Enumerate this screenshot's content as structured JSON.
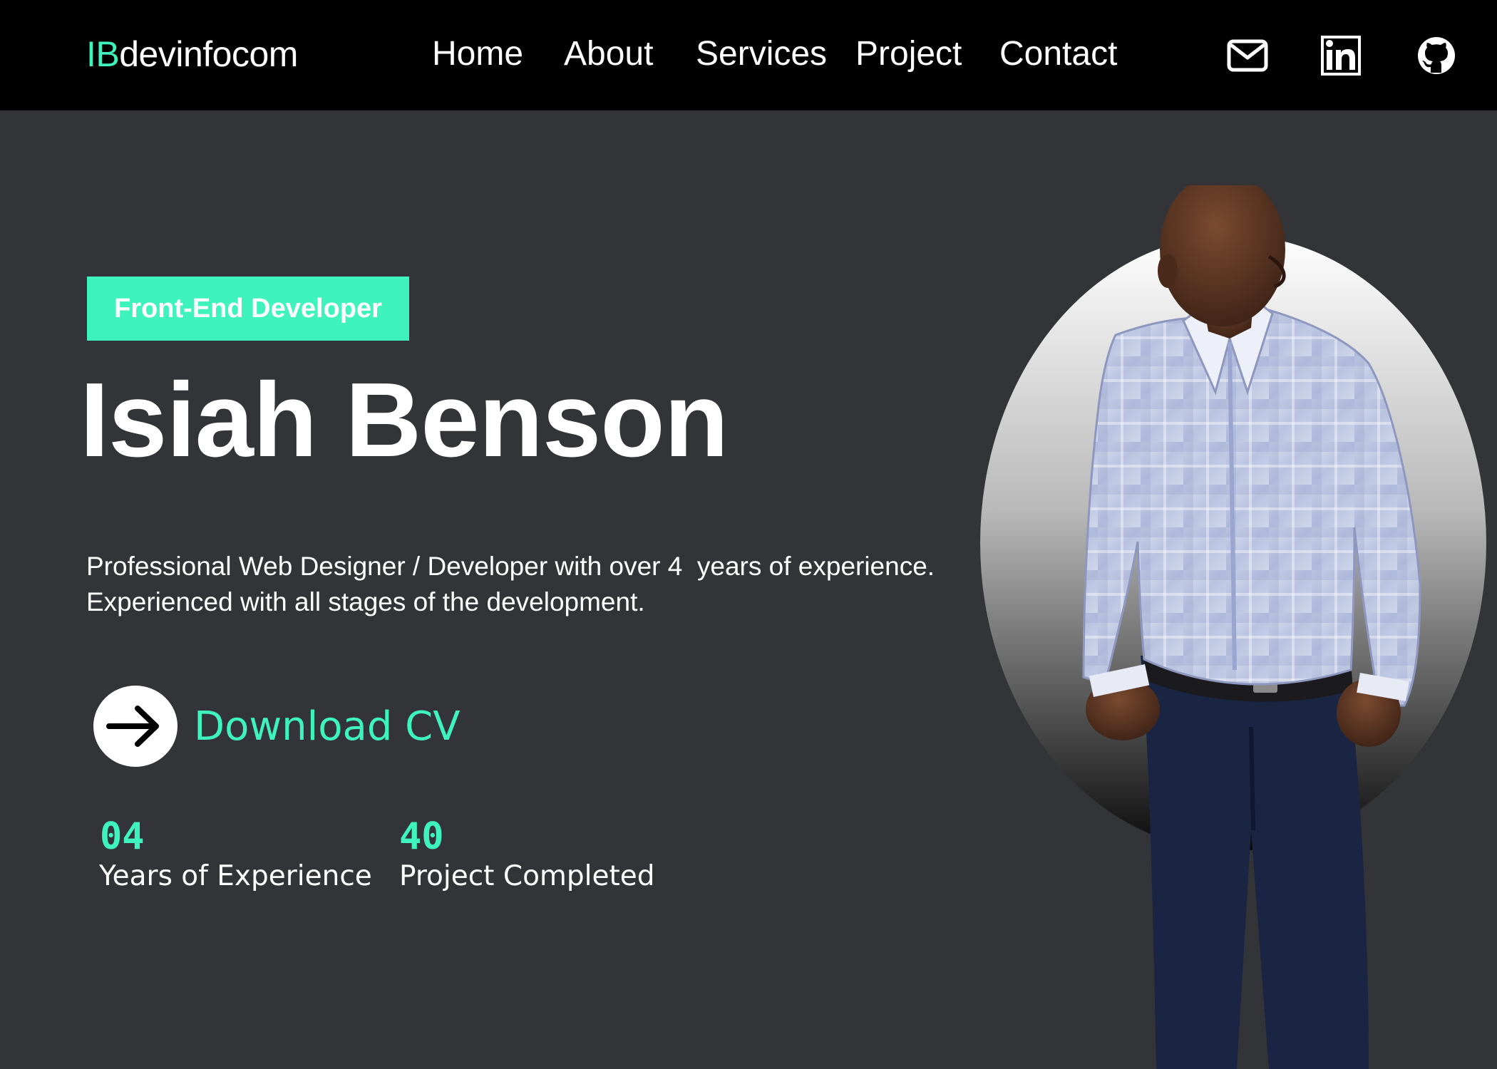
{
  "header": {
    "logo_accent": "IB",
    "logo_rest": "devinfocom",
    "nav": [
      "Home",
      "About",
      "Services",
      "Project",
      "Contact"
    ],
    "social_icons": [
      "mail-icon",
      "linkedin-icon",
      "github-icon"
    ]
  },
  "hero": {
    "role": "Front-End Developer",
    "name": "Isiah Benson",
    "bio_line1": "Professional Web Designer / Developer with over 4  years of experience.",
    "bio_line2": "Experienced with all stages of the development.",
    "cv_label": "Download CV",
    "cv_icon": "arrow-right-icon",
    "stats": [
      {
        "value": "04",
        "label": "Years of Experience"
      },
      {
        "value": "40",
        "label": "Project Completed"
      }
    ]
  },
  "colors": {
    "accent": "#3ff3bd",
    "background": "#333437",
    "header": "#000000",
    "text": "#ffffff"
  }
}
